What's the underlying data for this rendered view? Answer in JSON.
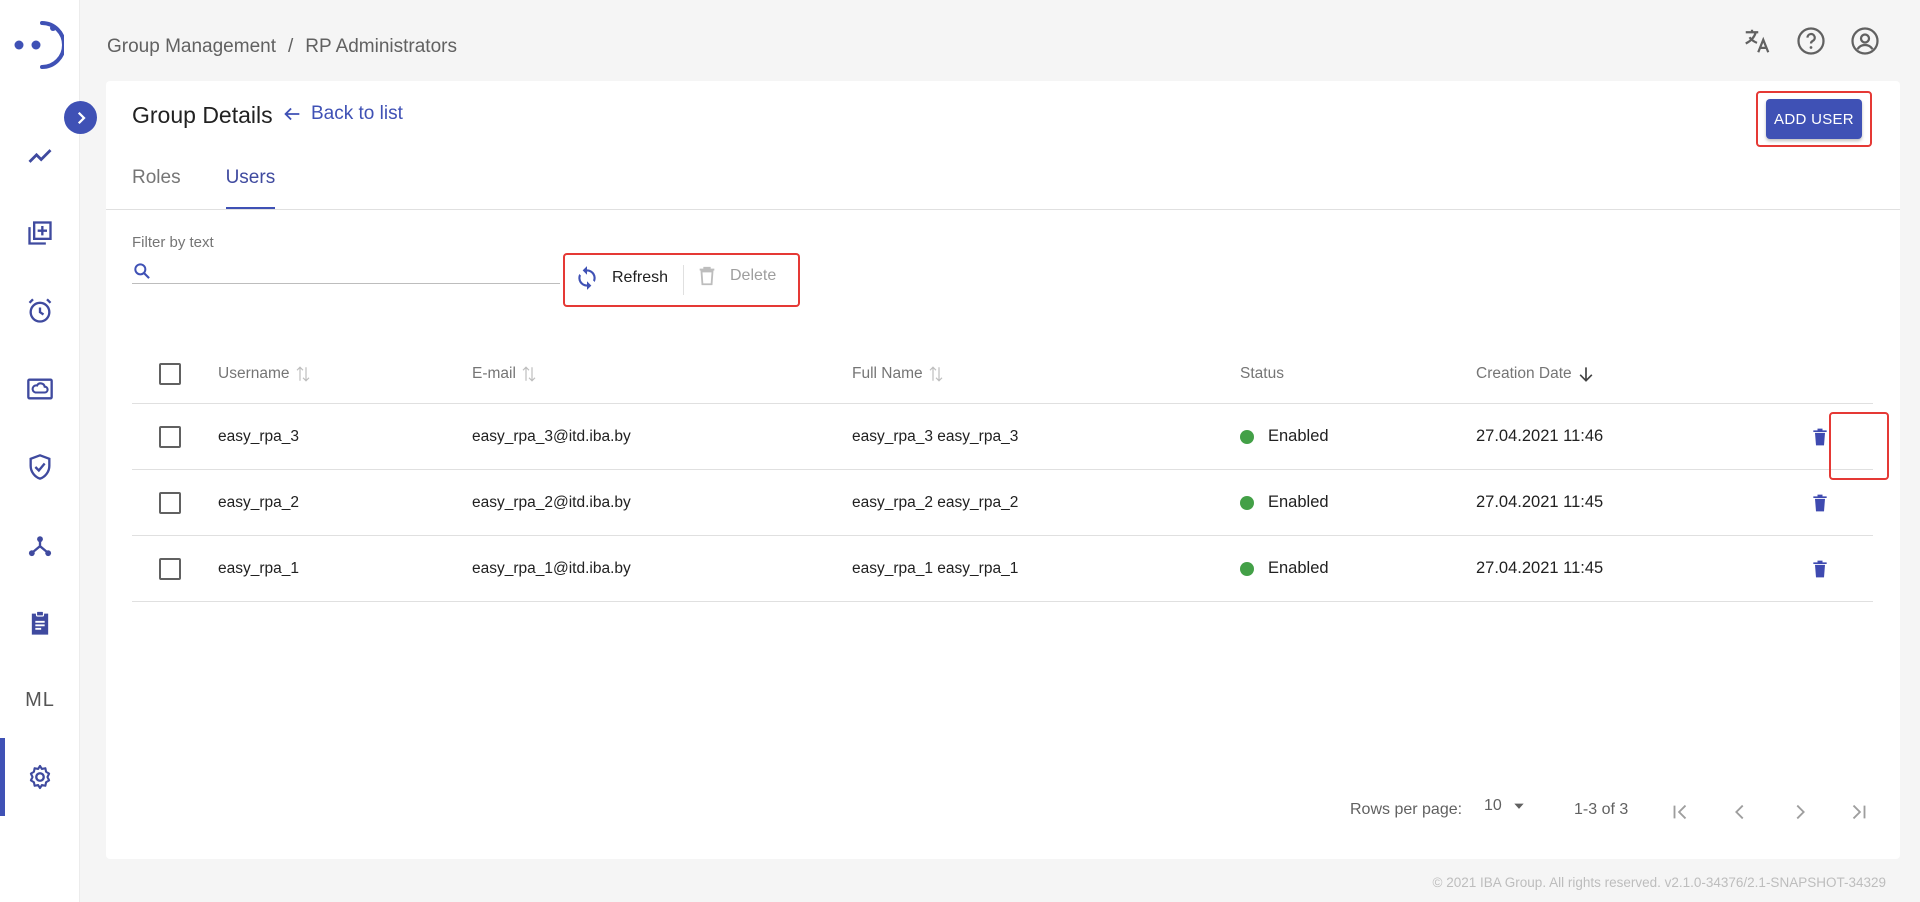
{
  "breadcrumb": {
    "parent": "Group Management",
    "separator": "/",
    "current": "RP Administrators"
  },
  "top_icons": [
    "translate-icon",
    "help-icon",
    "account-icon"
  ],
  "sidebar": {
    "items": [
      {
        "name": "analytics",
        "icon": "trend-icon"
      },
      {
        "name": "library",
        "icon": "library-add-icon"
      },
      {
        "name": "scheduler",
        "icon": "alarm-icon"
      },
      {
        "name": "cloud",
        "icon": "cloud-screen-icon"
      },
      {
        "name": "security",
        "icon": "shield-check-icon"
      },
      {
        "name": "workflow",
        "icon": "hub-icon"
      },
      {
        "name": "tasks",
        "icon": "clipboard-icon"
      },
      {
        "name": "ml",
        "label": "ML"
      },
      {
        "name": "settings",
        "icon": "gear-icon",
        "active": true
      }
    ]
  },
  "page": {
    "title": "Group Details",
    "back_label": "Back to list",
    "add_user_label": "ADD USER",
    "tabs": [
      {
        "label": "Roles",
        "active": false
      },
      {
        "label": "Users",
        "active": true
      }
    ]
  },
  "filter": {
    "label": "Filter by text",
    "value": ""
  },
  "actions": {
    "refresh_label": "Refresh",
    "delete_label": "Delete"
  },
  "table": {
    "columns": {
      "username": "Username",
      "email": "E-mail",
      "full_name": "Full Name",
      "status": "Status",
      "creation_date": "Creation Date"
    },
    "rows": [
      {
        "username": "easy_rpa_3",
        "email": "easy_rpa_3@itd.iba.by",
        "full_name": "easy_rpa_3 easy_rpa_3",
        "status": "Enabled",
        "creation_date": "27.04.2021 11:46"
      },
      {
        "username": "easy_rpa_2",
        "email": "easy_rpa_2@itd.iba.by",
        "full_name": "easy_rpa_2 easy_rpa_2",
        "status": "Enabled",
        "creation_date": "27.04.2021 11:45"
      },
      {
        "username": "easy_rpa_1",
        "email": "easy_rpa_1@itd.iba.by",
        "full_name": "easy_rpa_1 easy_rpa_1",
        "status": "Enabled",
        "creation_date": "27.04.2021 11:45"
      }
    ]
  },
  "pagination": {
    "rows_per_page_label": "Rows per page:",
    "rows_per_page": "10",
    "range": "1-3 of 3"
  },
  "footer": "© 2021 IBA Group. All rights reserved. v2.1.0-34376/2.1-SNAPSHOT-34329",
  "colors": {
    "primary": "#3f51b5",
    "highlight": "#e53935",
    "status_enabled": "#43a047"
  }
}
